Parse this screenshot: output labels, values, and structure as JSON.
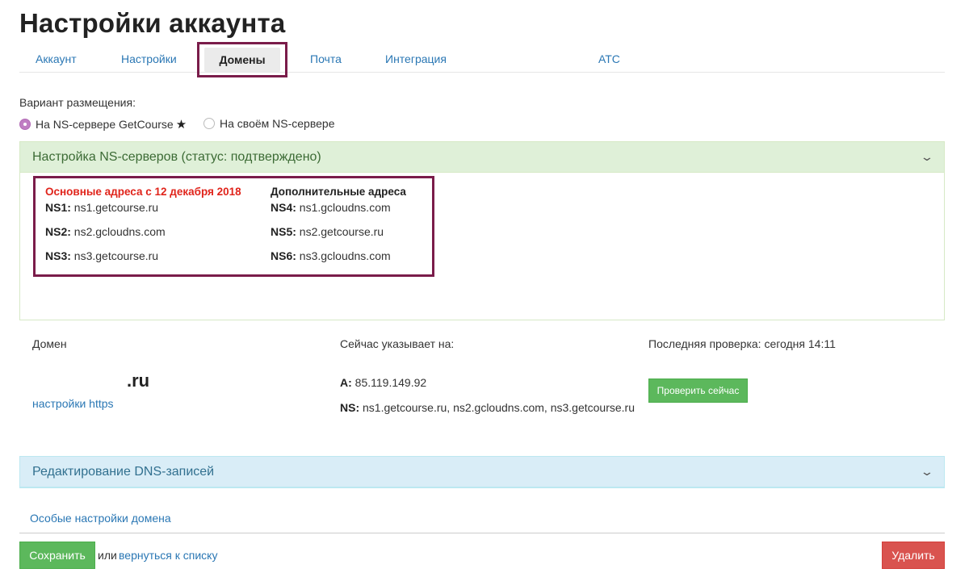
{
  "page_title": "Настройки аккаунта",
  "tabs": [
    {
      "label": "Аккаунт"
    },
    {
      "label": "Настройки"
    },
    {
      "label": "Домены",
      "active": true
    },
    {
      "label": "Почта"
    },
    {
      "label": "Интеграция"
    },
    {
      "label": "АТС"
    }
  ],
  "placement": {
    "label": "Вариант размещения:",
    "options": [
      {
        "label": "На NS-сервере GetCourse",
        "selected": true,
        "star": "★"
      },
      {
        "label": "На своём NS-сервере",
        "selected": false
      }
    ]
  },
  "ns_panel": {
    "title": "Настройка NS-серверов (статус: подтверждено)",
    "primary": {
      "heading": "Основные адреса с 12 декабря 2018",
      "rows": [
        {
          "key": "NS1:",
          "value": "ns1.getcourse.ru"
        },
        {
          "key": "NS2:",
          "value": "ns2.gcloudns.com"
        },
        {
          "key": "NS3:",
          "value": "ns3.getcourse.ru"
        }
      ]
    },
    "secondary": {
      "heading": "Дополнительные адреса",
      "rows": [
        {
          "key": "NS4:",
          "value": "ns1.gcloudns.com"
        },
        {
          "key": "NS5:",
          "value": "ns2.getcourse.ru"
        },
        {
          "key": "NS6:",
          "value": "ns3.gcloudns.com"
        }
      ]
    }
  },
  "domain": {
    "col_domain_label": "Домен",
    "col_points_label": "Сейчас указывает на:",
    "col_check_label": "Последняя проверка: сегодня 14:11",
    "name": ".ru",
    "https_link": "настройки https",
    "a_key": "A:",
    "a_value": "85.119.149.92",
    "ns_key": "NS:",
    "ns_value": "ns1.getcourse.ru, ns2.gcloudns.com, ns3.getcourse.ru",
    "check_button": "Проверить сейчас"
  },
  "dns_panel": {
    "title": "Редактирование DNS-записей"
  },
  "special_settings_link": "Особые настройки домена",
  "footer": {
    "save_button": "Сохранить",
    "or_text": "или",
    "back_link": "вернуться к списку",
    "delete_button": "Удалить"
  },
  "colors": {
    "link": "#2a77b4",
    "highlight_border": "#7a1c4a",
    "success": "#5cb85c",
    "danger": "#d9534f",
    "red_heading": "#e0241b"
  }
}
